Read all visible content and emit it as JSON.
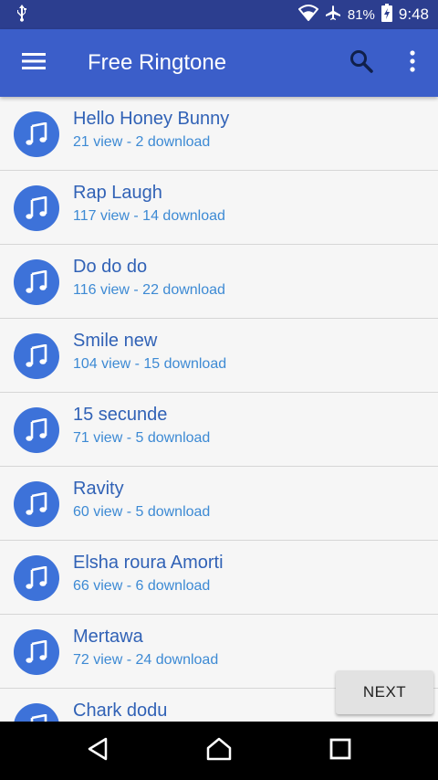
{
  "status_bar": {
    "icons": [
      "usb-icon",
      "wifi-icon",
      "airplane-icon",
      "battery-charging-icon"
    ],
    "battery": "81%",
    "time": "9:48"
  },
  "app_bar": {
    "title": "Free Ringtone",
    "icons": [
      "menu-icon",
      "search-icon",
      "more-vert-icon"
    ]
  },
  "ringtones": [
    {
      "title": "Hello Honey Bunny",
      "stats": "21 view - 2 download"
    },
    {
      "title": "Rap Laugh",
      "stats": "117 view - 14 download"
    },
    {
      "title": "Do do do",
      "stats": "116 view - 22 download"
    },
    {
      "title": "Smile new",
      "stats": "104 view - 15 download"
    },
    {
      "title": "15 secunde",
      "stats": "71 view - 5 download"
    },
    {
      "title": "Ravity",
      "stats": "60 view - 5 download"
    },
    {
      "title": "Elsha roura Amorti",
      "stats": "66 view - 6 download"
    },
    {
      "title": "Mertawa",
      "stats": "72 view - 24 download"
    },
    {
      "title": "Chark dodu",
      "stats": ""
    }
  ],
  "next_button": {
    "label": "NEXT"
  },
  "nav_bar": {
    "icons": [
      "back-icon",
      "home-icon",
      "recents-icon"
    ]
  },
  "colors": {
    "status_bar": "#2c3e8f",
    "app_bar": "#3b5ec9",
    "icon_circle": "#3d72d9",
    "title_text": "#3162b6",
    "stats_text": "#3d8ad4"
  }
}
